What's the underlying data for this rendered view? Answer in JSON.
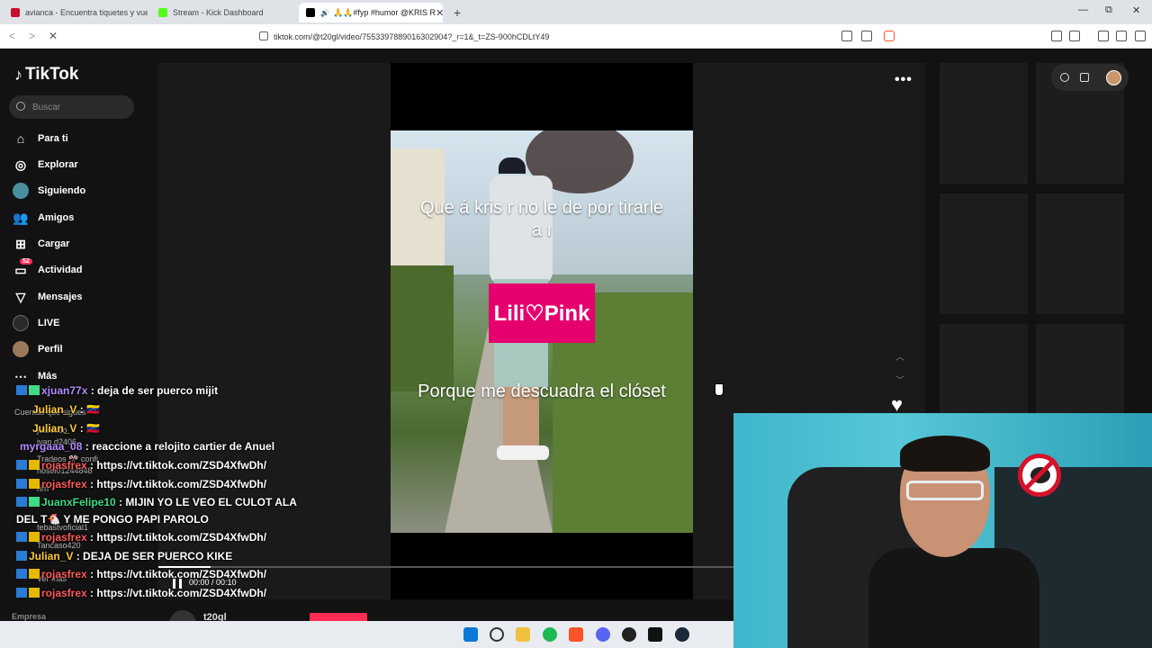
{
  "browser": {
    "tabs": [
      {
        "label": "avianca - Encuentra tiquetes y vuelos",
        "color": "#c8102e"
      },
      {
        "label": "Stream - Kick Dashboard",
        "color": "#53fc18"
      },
      {
        "label": "🙏🙏#fyp #humor @KRIS R",
        "color": "#000000"
      }
    ],
    "new_tab": "+",
    "url": "tiktok.com/@t20gl/video/7553397889016302904?_r=1&_t=ZS-900hCDLtY49",
    "controls": {
      "minimize": "—",
      "maximize": "⧉",
      "close": "✕"
    }
  },
  "sidebar": {
    "logo": "TikTok",
    "search_placeholder": "Buscar",
    "items": [
      {
        "label": "Para ti",
        "icon": "home-icon"
      },
      {
        "label": "Explorar",
        "icon": "compass-icon"
      },
      {
        "label": "Siguiendo",
        "icon": "following-icon"
      },
      {
        "label": "Amigos",
        "icon": "friends-icon"
      },
      {
        "label": "Cargar",
        "icon": "upload-icon"
      },
      {
        "label": "Actividad",
        "icon": "activity-icon",
        "badge": "52"
      },
      {
        "label": "Mensajes",
        "icon": "messages-icon"
      },
      {
        "label": "LIVE",
        "icon": "live-icon"
      },
      {
        "label": "Perfil",
        "icon": "profile-icon"
      },
      {
        "label": "Más",
        "icon": "more-icon"
      }
    ],
    "following_title": "Cuentas que sigues",
    "ver_mas": "Ver más",
    "empresa": "Empresa",
    "ghost_accounts": [
      "juank.co",
      "ivan.d2406",
      "Tradeos 🎌 confi",
      "nosoi01244848",
      "rirrr",
      "tebastvoficial1",
      "Tancaso420",
      "Juliancito420"
    ]
  },
  "video": {
    "caption_top": "Que á kris r no le de por tirarle a ı",
    "pink_label": "Lili♡Pink",
    "caption_bottom": "Porque me descuadra el clóset",
    "time": "00:00 / 00:10",
    "author": "t20gl",
    "progress": 0.09
  },
  "chat": [
    {
      "user": "xjuan77x",
      "msg": ": deja de ser puerco mijit",
      "color": "#b48cff"
    },
    {
      "user": "Julian_V",
      "msg": ": 🇻🇪",
      "color": "#ffcc33"
    },
    {
      "user": "Julian_V",
      "msg": ": 🇻🇪",
      "color": "#ffcc33"
    },
    {
      "user": "myrgaaa_08",
      "msg": ": reaccione a relojito cartier de Anuel",
      "color": "#b48cff"
    },
    {
      "user": "rojasfrex",
      "msg": ": https://vt.tiktok.com/ZSD4XfwDh/",
      "color": "#ff5a5a"
    },
    {
      "user": "rojasfrex",
      "msg": ": https://vt.tiktok.com/ZSD4XfwDh/",
      "color": "#ff5a5a"
    },
    {
      "user": "JuanxFelipe10",
      "msg": ": MIJIN YO LE VEO EL CULOT ALA",
      "color": "#3ddc84"
    },
    {
      "user": "",
      "msg": "DEL T🐔 Y ME PONGO PAPI PAROLO",
      "color": "#ffffff"
    },
    {
      "user": "rojasfrex",
      "msg": ": https://vt.tiktok.com/ZSD4XfwDh/",
      "color": "#ff5a5a"
    },
    {
      "user": "Julian_V",
      "msg": ": DEJA DE SER PUERCO KIKE",
      "color": "#ffcc33"
    },
    {
      "user": "rojasfrex",
      "msg": ": https://vt.tiktok.com/ZSD4XfwDh/",
      "color": "#ff5a5a"
    },
    {
      "user": "rojasfrex",
      "msg": ": https://vt.tiktok.com/ZSD4XfwDh/",
      "color": "#ff5a5a"
    }
  ],
  "colors": {
    "accent": "#fe2c55",
    "bg": "#121212"
  }
}
